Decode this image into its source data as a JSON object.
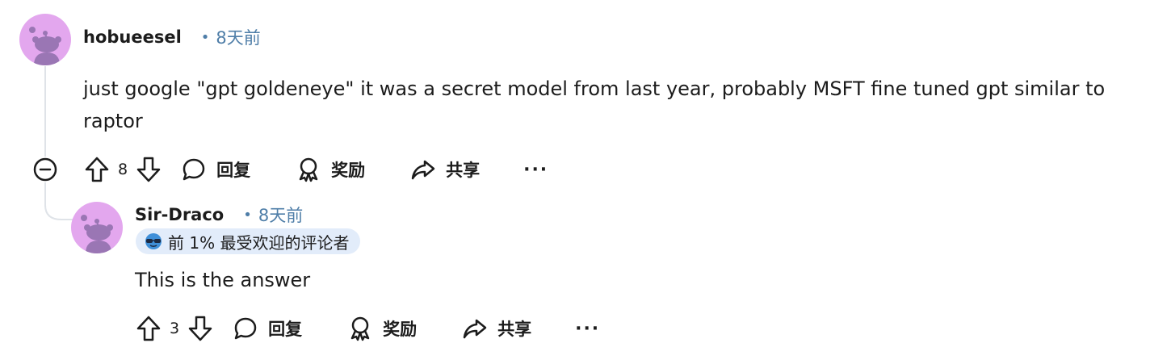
{
  "comments": [
    {
      "username": "hobueesel",
      "separator": "•",
      "time": "8天前",
      "body": "just google \"gpt goldeneye\" it was a secret model from last year, probably MSFT fine tuned gpt similar to raptor",
      "votes": "8",
      "reply_label": "回复",
      "award_label": "奖励",
      "share_label": "共享",
      "more_label": "···"
    },
    {
      "username": "Sir-Draco",
      "separator": "•",
      "time": "8天前",
      "badge": "前 1% 最受欢迎的评论者",
      "body": "This is the answer",
      "votes": "3",
      "reply_label": "回复",
      "award_label": "奖励",
      "share_label": "共享",
      "more_label": "···"
    }
  ],
  "colors": {
    "avatar_bg": "#e3a7ee",
    "snoo": "#9a76b4",
    "time_link": "#4f7ea8",
    "badge_bg": "#e2ecfa",
    "thread_line": "#dfe3e8"
  }
}
